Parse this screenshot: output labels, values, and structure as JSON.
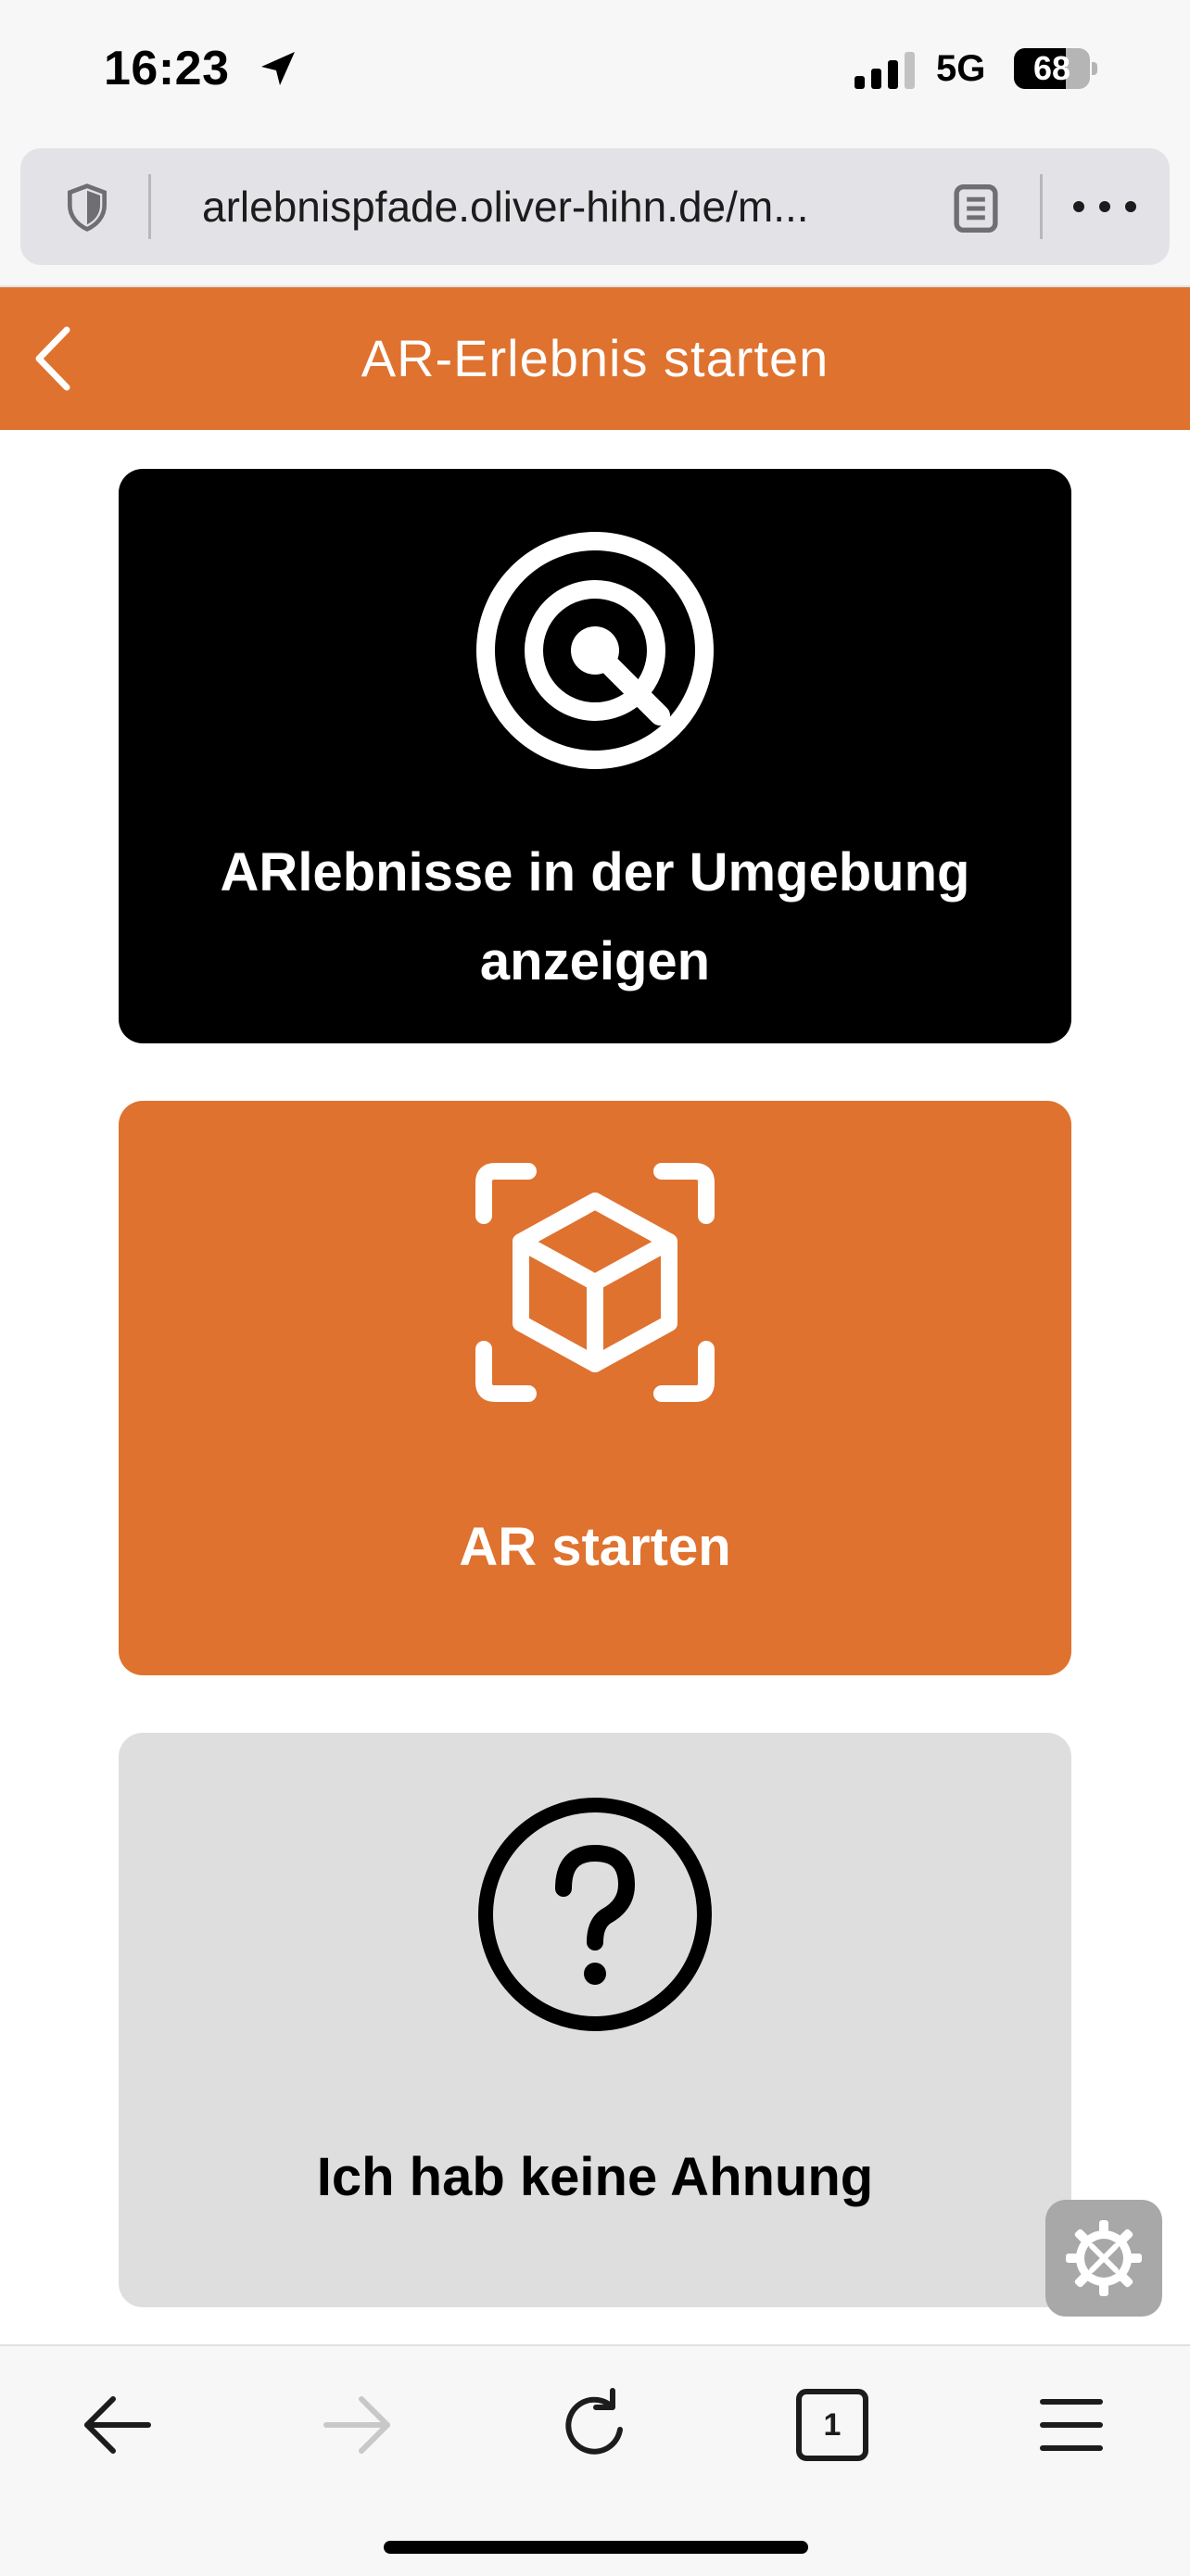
{
  "status_bar": {
    "time": "16:23",
    "network": "5G",
    "battery": "68",
    "battery_level": 0.68
  },
  "browser": {
    "url": "arlebnispfade.oliver-hihn.de/m..."
  },
  "header": {
    "title": "AR-Erlebnis starten"
  },
  "cards": [
    {
      "label": "ARlebnisse in der Umgebung anzeigen",
      "icon": "radar-search-icon",
      "color": "#000000"
    },
    {
      "label": "AR starten",
      "icon": "ar-cube-icon",
      "color": "#df722f"
    },
    {
      "label": "Ich hab keine Ahnung",
      "icon": "question-circle-icon",
      "color": "#dedede"
    }
  ],
  "toolbar": {
    "tab_count": "1"
  },
  "colors": {
    "accent": "#df722f",
    "dark_card": "#000000",
    "light_card": "#dedede"
  }
}
